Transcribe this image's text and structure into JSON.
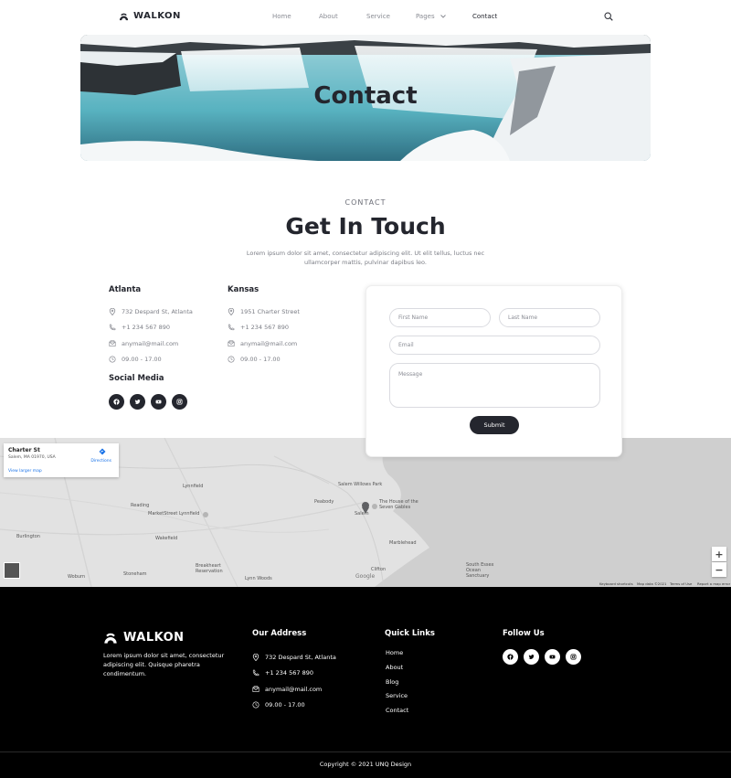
{
  "nav": {
    "logo": "WALKON",
    "items": [
      {
        "label": "Home"
      },
      {
        "label": "About"
      },
      {
        "label": "Service"
      },
      {
        "label": "Pages"
      },
      {
        "label": "Contact"
      }
    ],
    "active": "Contact",
    "search_icon": "search-icon"
  },
  "hero": {
    "title": "Contact"
  },
  "section": {
    "eyebrow": "CONTACT",
    "title": "Get In Touch",
    "text": "Lorem ipsum dolor sit amet, consectetur adipiscing elit. Ut elit tellus, luctus nec ullamcorper mattis, pulvinar dapibus leo."
  },
  "offices": [
    {
      "city": "Atlanta",
      "address": "732 Despard St, Atlanta",
      "phone": "+1 234 567 890",
      "email": "anymail@mail.com",
      "hours": "09.00 - 17.00"
    },
    {
      "city": "Kansas",
      "address": "1951 Charter Street",
      "phone": "+1 234 567 890",
      "email": "anymail@mail.com",
      "hours": "09.00 - 17.00"
    }
  ],
  "social": {
    "title": "Social Media",
    "icons": [
      "facebook-icon",
      "twitter-icon",
      "youtube-icon",
      "instagram-icon"
    ]
  },
  "form": {
    "first_name_placeholder": "First Name",
    "last_name_placeholder": "Last Name",
    "email_placeholder": "Email",
    "message_placeholder": "Message",
    "submit_label": "Submit"
  },
  "map": {
    "card_title": "Charter St",
    "card_address": "Salem, MA 01970, USA",
    "directions": "Directions",
    "view_larger": "View larger map",
    "labels": [
      "Lynnfield",
      "Reading",
      "MarketStreet Lynnfield",
      "Wakefield",
      "Burlington",
      "Woburn",
      "Stoneham",
      "Breakheart Reservation",
      "Lynn Woods",
      "Peabody",
      "Salem Willows Park",
      "The House of the Seven Gables",
      "Salem",
      "Marblehead",
      "Clifton",
      "South Essex Ocean Sanctuary",
      "Google"
    ],
    "attribution": [
      "Keyboard shortcuts",
      "Map data ©2021",
      "Terms of Use",
      "Report a map error"
    ],
    "zoom_in": "+",
    "zoom_out": "−"
  },
  "footer": {
    "logo": "WALKON",
    "about": "Lorem ipsum dolor sit amet, consectetur adipiscing elit. Quisque pharetra condimentum.",
    "address_title": "Our Address",
    "address": "732 Despard St, Atlanta",
    "phone": "+1 234 567 890",
    "email": "anymail@mail.com",
    "hours": "09.00 - 17.00",
    "links_title": "Quick Links",
    "links": [
      {
        "label": "Home"
      },
      {
        "label": "About"
      },
      {
        "label": "Blog"
      },
      {
        "label": "Service"
      },
      {
        "label": "Contact"
      }
    ],
    "follow_title": "Follow Us",
    "copyright": "Copyright © 2021 UNQ Design"
  },
  "colors": {
    "dark": "#24262e",
    "muted": "#7b7d85",
    "footer_bg": "#000000",
    "map_land": "#e2e2e2",
    "map_water": "#cfcfcf"
  }
}
